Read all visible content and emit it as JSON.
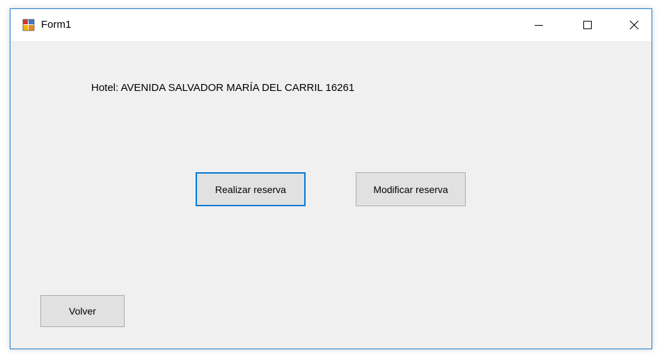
{
  "window": {
    "title": "Form1",
    "icon": "winforms-app-icon",
    "controls": {
      "minimize_icon": "minimize-icon",
      "maximize_icon": "maximize-icon",
      "close_icon": "close-icon"
    },
    "accent_color": "#1a7fd6"
  },
  "form": {
    "hotel_label": "Hotel: AVENIDA SALVADOR MARÍA DEL CARRIL 16261",
    "buttons": {
      "realizar_reserva": "Realizar reserva",
      "modificar_reserva": "Modificar reserva",
      "volver": "Volver"
    },
    "focused_button_color": "#0078d7",
    "background_color": "#f0f0f0"
  }
}
